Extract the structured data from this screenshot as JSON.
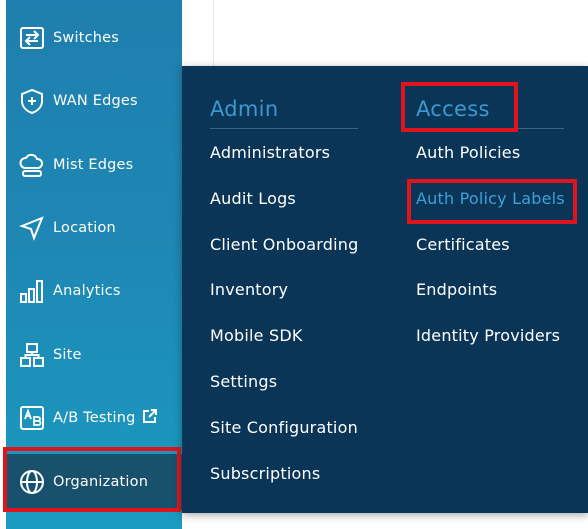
{
  "sidebar": {
    "items": [
      {
        "label": "Switches",
        "icon": "switches-icon"
      },
      {
        "label": "WAN Edges",
        "icon": "wan-edges-shield-icon"
      },
      {
        "label": "Mist Edges",
        "icon": "mist-edges-cloud-icon"
      },
      {
        "label": "Location",
        "icon": "location-arrow-icon"
      },
      {
        "label": "Analytics",
        "icon": "analytics-bars-icon"
      },
      {
        "label": "Site",
        "icon": "site-hierarchy-icon"
      },
      {
        "label": "A/B Testing",
        "icon": "ab-testing-icon",
        "external_link_icon": "external-link-icon"
      },
      {
        "label": "Organization",
        "icon": "globe-icon",
        "selected": true
      }
    ]
  },
  "menu": {
    "admin": {
      "title": "Admin",
      "items": [
        "Administrators",
        "Audit Logs",
        "Client Onboarding",
        "Inventory",
        "Mobile SDK",
        "Settings",
        "Site Configuration",
        "Subscriptions"
      ]
    },
    "access": {
      "title": "Access",
      "items": [
        "Auth Policies",
        "Auth Policy Labels",
        "Certificates",
        "Endpoints",
        "Identity Providers"
      ],
      "active_item": "Auth Policy Labels"
    }
  },
  "colors": {
    "sidebar_top": "#1f7fae",
    "sidebar_bottom": "#1a9bc0",
    "flyout_bg": "#0a3556",
    "accent_blue": "#3a9ad0",
    "highlight_red": "#e0141c",
    "selected_bg": "#18516c"
  }
}
